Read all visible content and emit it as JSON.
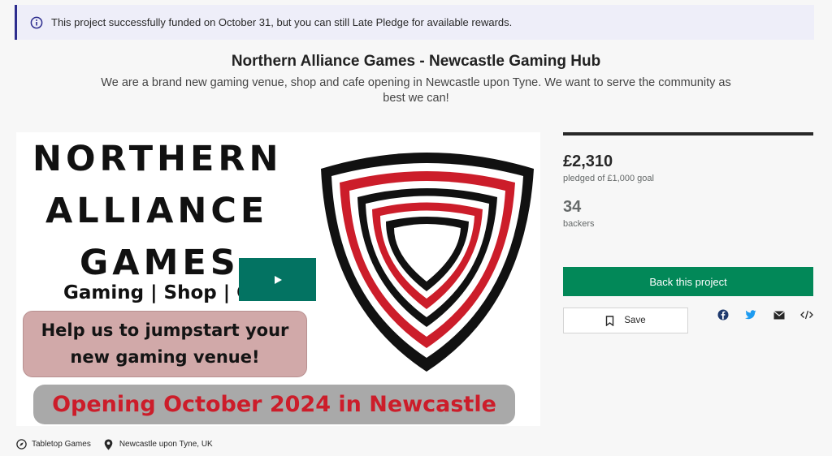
{
  "notice": {
    "text": "This project successfully funded on October 31, but you can still Late Pledge for available rewards.",
    "icon": "info-icon"
  },
  "project": {
    "title": "Northern Alliance Games - Newcastle Gaming Hub",
    "blurb": "We are a brand new gaming venue, shop and cafe opening in Newcastle upon Tyne. We want to serve the community as best we can!"
  },
  "media": {
    "wordmark_line1": "NORTHERN",
    "wordmark_line2": "ALLIANCE",
    "wordmark_line3": "GAMES",
    "tagline": "Gaming | Shop | Cafe",
    "pink_line1": "Help us to jumpstart your",
    "pink_line2": "new gaming venue!",
    "banner": "Opening October 2024 in Newcastle",
    "play_icon": "play-icon"
  },
  "stats": {
    "pledged": "£2,310",
    "goal_text": "pledged of £1,000 goal",
    "backers": "34",
    "backers_label": "backers"
  },
  "actions": {
    "back_label": "Back this project",
    "save_label": "Save"
  },
  "social": [
    "facebook-icon",
    "twitter-icon",
    "mail-icon",
    "embed-icon"
  ],
  "meta": {
    "category": "Tabletop Games",
    "location": "Newcastle upon Tyne, UK"
  },
  "colors": {
    "accent_green": "#028858",
    "play_green": "#037362",
    "notice_border": "#2d2d8e",
    "shield_red": "#cc1d2a"
  }
}
